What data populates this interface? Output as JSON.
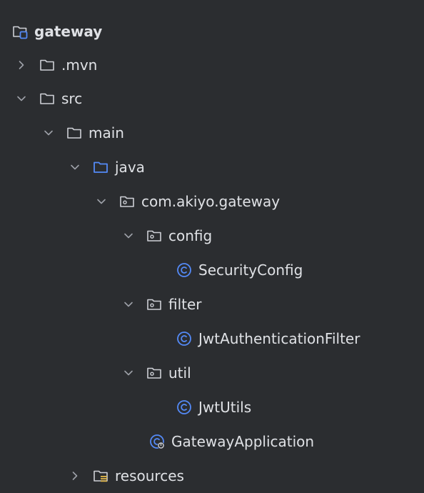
{
  "tree": {
    "root": {
      "label": "gateway",
      "icon": "module-folder-icon"
    },
    "items": [
      {
        "label": ".mvn",
        "expanded": false,
        "icon": "folder-icon"
      },
      {
        "label": "src",
        "expanded": true,
        "icon": "folder-icon"
      },
      {
        "label": "main",
        "expanded": true,
        "icon": "folder-icon"
      },
      {
        "label": "java",
        "expanded": true,
        "icon": "source-root-folder-icon"
      },
      {
        "label": "com.akiyo.gateway",
        "expanded": true,
        "icon": "package-icon"
      },
      {
        "label": "config",
        "expanded": true,
        "icon": "package-icon"
      },
      {
        "label": "SecurityConfig",
        "icon": "class-icon"
      },
      {
        "label": "filter",
        "expanded": true,
        "icon": "package-icon"
      },
      {
        "label": "JwtAuthenticationFilter",
        "icon": "class-icon"
      },
      {
        "label": "util",
        "expanded": true,
        "icon": "package-icon"
      },
      {
        "label": "JwtUtils",
        "icon": "class-icon"
      },
      {
        "label": "GatewayApplication",
        "icon": "spring-boot-class-icon"
      },
      {
        "label": "resources",
        "expanded": false,
        "icon": "resources-folder-icon"
      }
    ]
  },
  "colors": {
    "background": "#2b2d30",
    "text": "#dfe1e5",
    "icon_outline": "#ced0d6",
    "accent_blue": "#548af7",
    "chevron": "#9da0a8"
  }
}
